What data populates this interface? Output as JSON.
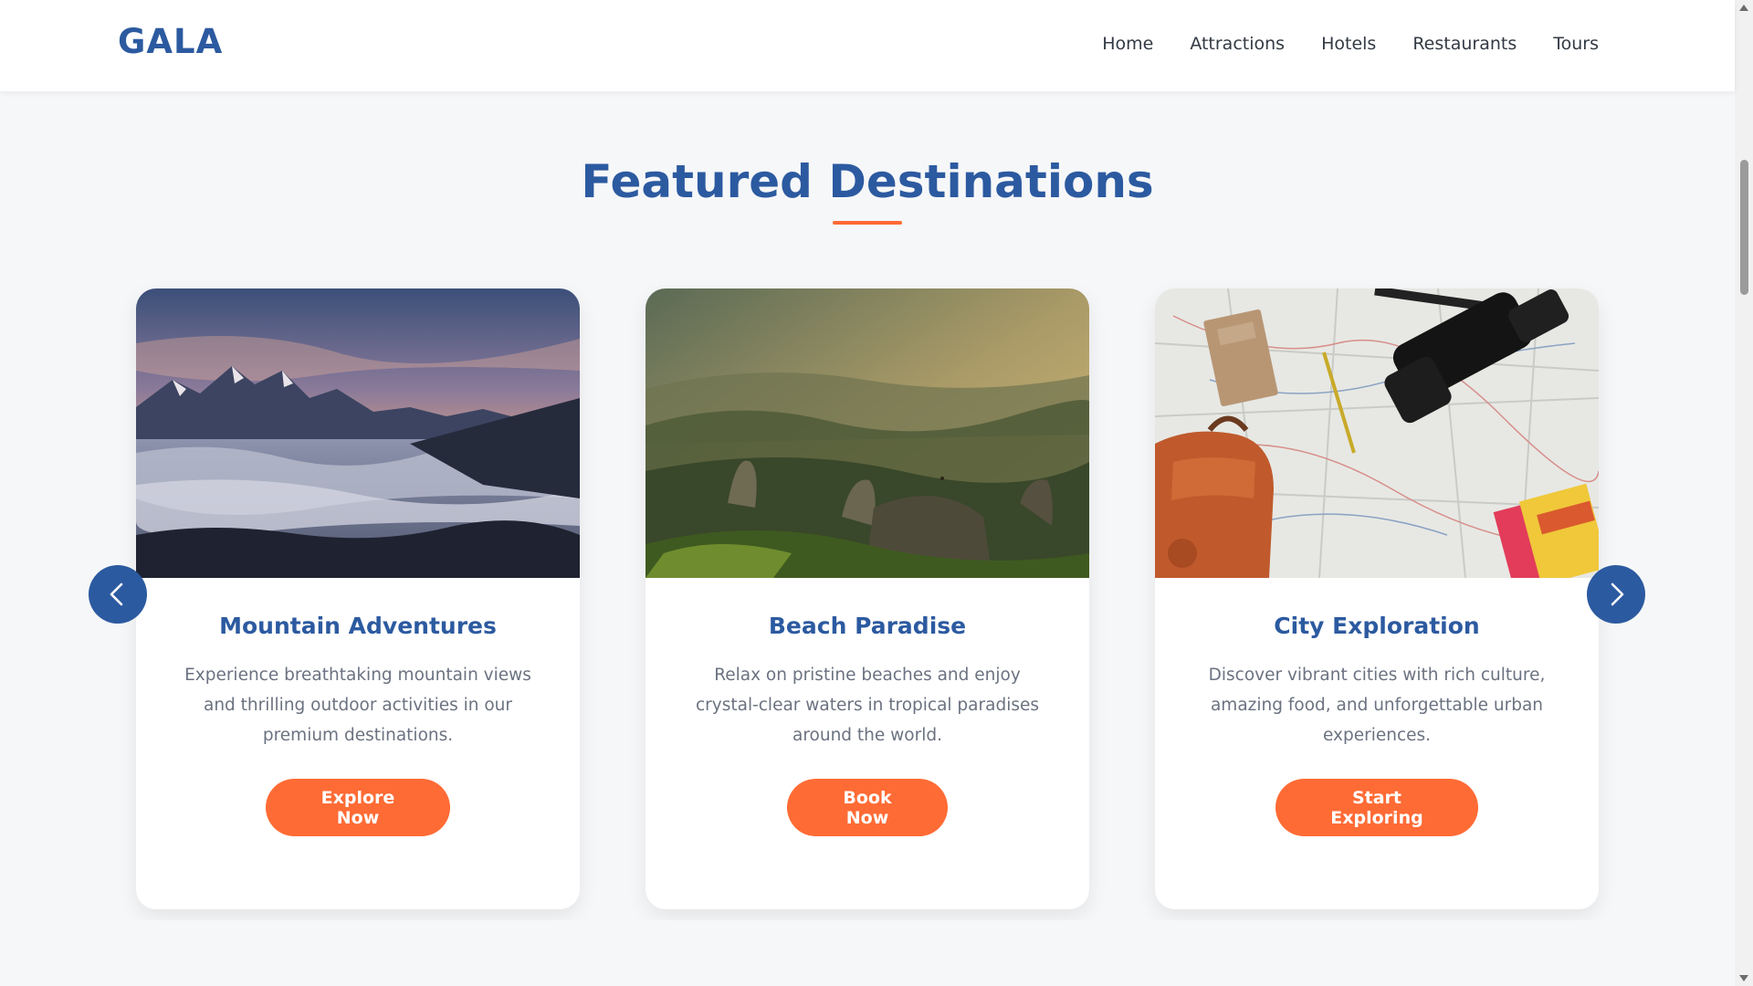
{
  "header": {
    "logo": "GALA",
    "nav": [
      {
        "label": "Home"
      },
      {
        "label": "Attractions"
      },
      {
        "label": "Hotels"
      },
      {
        "label": "Restaurants"
      },
      {
        "label": "Tours"
      }
    ]
  },
  "section": {
    "title": "Featured Destinations"
  },
  "cards": [
    {
      "title": "Mountain Adventures",
      "description": "Experience breathtaking mountain views and thrilling outdoor activities in our premium destinations.",
      "button": "Explore Now",
      "image": "mountain-sunset-clouds"
    },
    {
      "title": "Beach Paradise",
      "description": "Relax on pristine beaches and enjoy crystal-clear waters in tropical paradises around the world.",
      "button": "Book Now",
      "image": "misty-valley-sunlight"
    },
    {
      "title": "City Exploration",
      "description": "Discover vibrant cities with rich culture, amazing food, and unforgettable urban experiences.",
      "button": "Start Exploring",
      "image": "map-camera-backpack"
    }
  ],
  "carousel": {
    "prev_icon": "chevron-left-icon",
    "next_icon": "chevron-right-icon"
  },
  "colors": {
    "brand": "#2c5aa0",
    "accent": "#ff6b35",
    "text_muted": "#6b7280"
  }
}
